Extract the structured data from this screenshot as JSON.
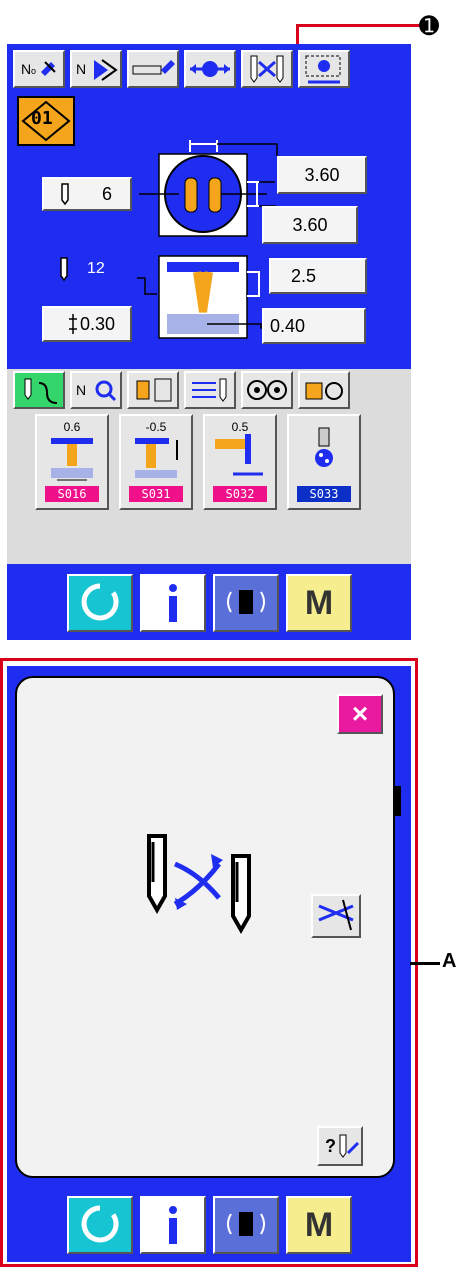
{
  "callout": {
    "marker": "➊"
  },
  "label_a": "A",
  "screen1": {
    "pattern_no": "01",
    "needle_count": "6",
    "hole_width": "3.60",
    "hole_height": "3.60",
    "thread_count": "12",
    "neck_height": "2.5",
    "offset": "0.30",
    "base_offset": "0.40",
    "cards": [
      {
        "value": "0.6",
        "code": "S016",
        "color": "#f0118a"
      },
      {
        "value": "-0.5",
        "code": "S031",
        "color": "#f0118a"
      },
      {
        "value": "0.5",
        "code": "S032",
        "color": "#f0118a"
      },
      {
        "value": "",
        "code": "S033",
        "color": "#0b2fc7"
      }
    ]
  },
  "bottom_bar": {
    "menu_label": "M"
  },
  "dialog": {
    "close_label": "×",
    "help_label": "?"
  }
}
